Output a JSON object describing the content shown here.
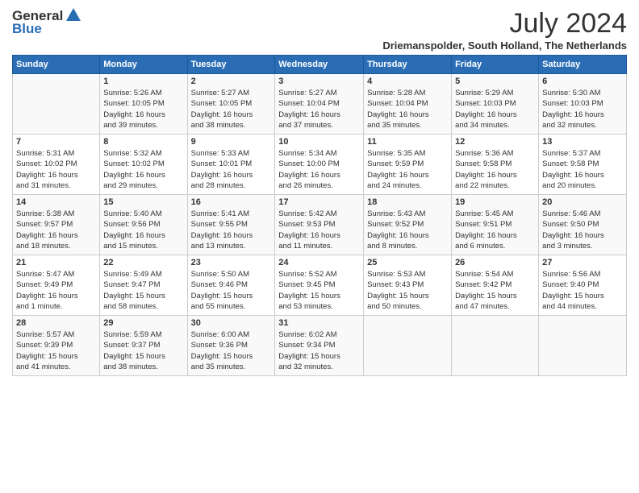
{
  "header": {
    "logo_general": "General",
    "logo_blue": "Blue",
    "title": "July 2024",
    "location": "Driemanspolder, South Holland, The Netherlands"
  },
  "calendar": {
    "weekdays": [
      "Sunday",
      "Monday",
      "Tuesday",
      "Wednesday",
      "Thursday",
      "Friday",
      "Saturday"
    ],
    "weeks": [
      [
        {
          "day": "",
          "content": ""
        },
        {
          "day": "1",
          "content": "Sunrise: 5:26 AM\nSunset: 10:05 PM\nDaylight: 16 hours\nand 39 minutes."
        },
        {
          "day": "2",
          "content": "Sunrise: 5:27 AM\nSunset: 10:05 PM\nDaylight: 16 hours\nand 38 minutes."
        },
        {
          "day": "3",
          "content": "Sunrise: 5:27 AM\nSunset: 10:04 PM\nDaylight: 16 hours\nand 37 minutes."
        },
        {
          "day": "4",
          "content": "Sunrise: 5:28 AM\nSunset: 10:04 PM\nDaylight: 16 hours\nand 35 minutes."
        },
        {
          "day": "5",
          "content": "Sunrise: 5:29 AM\nSunset: 10:03 PM\nDaylight: 16 hours\nand 34 minutes."
        },
        {
          "day": "6",
          "content": "Sunrise: 5:30 AM\nSunset: 10:03 PM\nDaylight: 16 hours\nand 32 minutes."
        }
      ],
      [
        {
          "day": "7",
          "content": "Sunrise: 5:31 AM\nSunset: 10:02 PM\nDaylight: 16 hours\nand 31 minutes."
        },
        {
          "day": "8",
          "content": "Sunrise: 5:32 AM\nSunset: 10:02 PM\nDaylight: 16 hours\nand 29 minutes."
        },
        {
          "day": "9",
          "content": "Sunrise: 5:33 AM\nSunset: 10:01 PM\nDaylight: 16 hours\nand 28 minutes."
        },
        {
          "day": "10",
          "content": "Sunrise: 5:34 AM\nSunset: 10:00 PM\nDaylight: 16 hours\nand 26 minutes."
        },
        {
          "day": "11",
          "content": "Sunrise: 5:35 AM\nSunset: 9:59 PM\nDaylight: 16 hours\nand 24 minutes."
        },
        {
          "day": "12",
          "content": "Sunrise: 5:36 AM\nSunset: 9:58 PM\nDaylight: 16 hours\nand 22 minutes."
        },
        {
          "day": "13",
          "content": "Sunrise: 5:37 AM\nSunset: 9:58 PM\nDaylight: 16 hours\nand 20 minutes."
        }
      ],
      [
        {
          "day": "14",
          "content": "Sunrise: 5:38 AM\nSunset: 9:57 PM\nDaylight: 16 hours\nand 18 minutes."
        },
        {
          "day": "15",
          "content": "Sunrise: 5:40 AM\nSunset: 9:56 PM\nDaylight: 16 hours\nand 15 minutes."
        },
        {
          "day": "16",
          "content": "Sunrise: 5:41 AM\nSunset: 9:55 PM\nDaylight: 16 hours\nand 13 minutes."
        },
        {
          "day": "17",
          "content": "Sunrise: 5:42 AM\nSunset: 9:53 PM\nDaylight: 16 hours\nand 11 minutes."
        },
        {
          "day": "18",
          "content": "Sunrise: 5:43 AM\nSunset: 9:52 PM\nDaylight: 16 hours\nand 8 minutes."
        },
        {
          "day": "19",
          "content": "Sunrise: 5:45 AM\nSunset: 9:51 PM\nDaylight: 16 hours\nand 6 minutes."
        },
        {
          "day": "20",
          "content": "Sunrise: 5:46 AM\nSunset: 9:50 PM\nDaylight: 16 hours\nand 3 minutes."
        }
      ],
      [
        {
          "day": "21",
          "content": "Sunrise: 5:47 AM\nSunset: 9:49 PM\nDaylight: 16 hours\nand 1 minute."
        },
        {
          "day": "22",
          "content": "Sunrise: 5:49 AM\nSunset: 9:47 PM\nDaylight: 15 hours\nand 58 minutes."
        },
        {
          "day": "23",
          "content": "Sunrise: 5:50 AM\nSunset: 9:46 PM\nDaylight: 15 hours\nand 55 minutes."
        },
        {
          "day": "24",
          "content": "Sunrise: 5:52 AM\nSunset: 9:45 PM\nDaylight: 15 hours\nand 53 minutes."
        },
        {
          "day": "25",
          "content": "Sunrise: 5:53 AM\nSunset: 9:43 PM\nDaylight: 15 hours\nand 50 minutes."
        },
        {
          "day": "26",
          "content": "Sunrise: 5:54 AM\nSunset: 9:42 PM\nDaylight: 15 hours\nand 47 minutes."
        },
        {
          "day": "27",
          "content": "Sunrise: 5:56 AM\nSunset: 9:40 PM\nDaylight: 15 hours\nand 44 minutes."
        }
      ],
      [
        {
          "day": "28",
          "content": "Sunrise: 5:57 AM\nSunset: 9:39 PM\nDaylight: 15 hours\nand 41 minutes."
        },
        {
          "day": "29",
          "content": "Sunrise: 5:59 AM\nSunset: 9:37 PM\nDaylight: 15 hours\nand 38 minutes."
        },
        {
          "day": "30",
          "content": "Sunrise: 6:00 AM\nSunset: 9:36 PM\nDaylight: 15 hours\nand 35 minutes."
        },
        {
          "day": "31",
          "content": "Sunrise: 6:02 AM\nSunset: 9:34 PM\nDaylight: 15 hours\nand 32 minutes."
        },
        {
          "day": "",
          "content": ""
        },
        {
          "day": "",
          "content": ""
        },
        {
          "day": "",
          "content": ""
        }
      ]
    ]
  }
}
